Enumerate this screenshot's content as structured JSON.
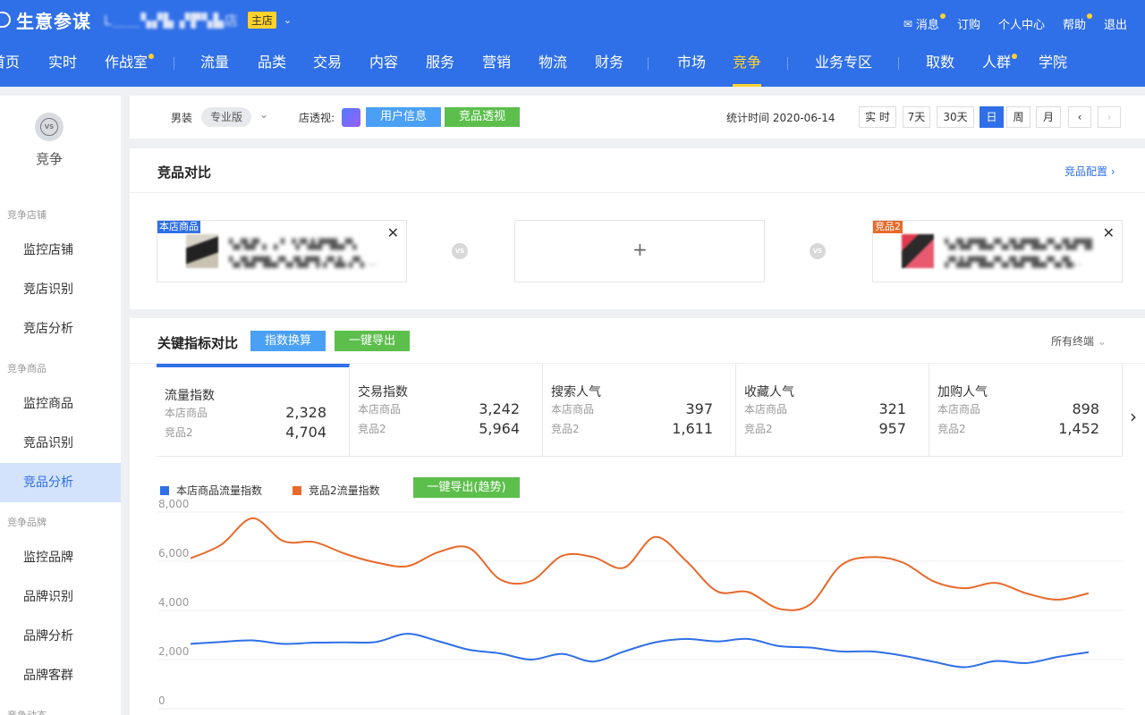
{
  "header": {
    "app_name": "生意参谋",
    "shop_name": "L＿＿▚▞▙ ▞▛▚▙店",
    "shop_badge": "主店",
    "links": [
      {
        "label": "消息",
        "dot": true
      },
      {
        "label": "订购",
        "dot": false
      },
      {
        "label": "个人中心",
        "dot": false
      },
      {
        "label": "帮助",
        "dot": true
      },
      {
        "label": "退出",
        "dot": false
      }
    ]
  },
  "nav": {
    "items": [
      {
        "label": "首页"
      },
      {
        "label": "实时"
      },
      {
        "label": "作战室",
        "dot": true
      },
      {
        "label": "流量"
      },
      {
        "label": "品类"
      },
      {
        "label": "交易"
      },
      {
        "label": "内容"
      },
      {
        "label": "服务"
      },
      {
        "label": "营销"
      },
      {
        "label": "物流"
      },
      {
        "label": "财务"
      },
      {
        "label": "市场"
      },
      {
        "label": "竞争",
        "active": true
      },
      {
        "label": "业务专区"
      },
      {
        "label": "取数"
      },
      {
        "label": "人群",
        "dot": true
      },
      {
        "label": "学院"
      }
    ]
  },
  "sidebar": {
    "title": "竞争",
    "icon_text": "VS",
    "groups": [
      "竞争店铺",
      "竞争商品",
      "竞争品牌",
      "竞争动态"
    ],
    "items": [
      "监控店铺",
      "竞店识别",
      "竞店分析",
      "监控商品",
      "竞品识别",
      "竞品分析",
      "监控品牌",
      "品牌识别",
      "品牌分析",
      "品牌客群"
    ],
    "active_item": "竞品分析"
  },
  "filter": {
    "category": "男装",
    "edition": "专业版",
    "insight_label": "店透视:",
    "user_info_button": "用户信息",
    "product_insight_button": "竞品透视",
    "stat_time": "统计时间 2020-06-14",
    "time_buttons": [
      "实 时",
      "7天",
      "30天",
      "日",
      "周",
      "月"
    ],
    "active_time": "日",
    "prev": "‹",
    "next": "›"
  },
  "compare": {
    "title": "竞品对比",
    "config_link": "竞品配置 ›",
    "slot1_tag": "本店商品",
    "slot1_text_line1": "▚▞▙▛ ▖▗ ▘▝▞▚▙▛▜▙▞▚",
    "slot1_text_line2": "▚▞▙▛▜▙▞▚▞▙▛▜ ▞▚▙ ▞▚ ...",
    "slot3_tag": "竞品2",
    "slot3_text_line1": "▚▞▙▛▜▙▞▚▞▙▛▜▙▞▚▞▙▛▜▙",
    "slot3_text_line2": "▞▚▙▛▜▙▞▚▞▙▛▜▙▞▚▞▙...",
    "add_symbol": "+",
    "vs": "VS",
    "close": "✕"
  },
  "metrics": {
    "title": "关键指标对比",
    "convert_button": "指数换算",
    "export_button": "一键导出",
    "terminal": "所有终端",
    "own_label": "本店商品",
    "rival_label": "竞品2",
    "cards": [
      {
        "name": "流量指数",
        "own": "2,328",
        "rival": "4,704"
      },
      {
        "name": "交易指数",
        "own": "3,242",
        "rival": "5,964"
      },
      {
        "name": "搜索人气",
        "own": "397",
        "rival": "1,611"
      },
      {
        "name": "收藏人气",
        "own": "321",
        "rival": "957"
      },
      {
        "name": "加购人气",
        "own": "898",
        "rival": "1,452"
      }
    ],
    "next_arrow": "›"
  },
  "trend": {
    "export_trend_button": "一键导出(趋势)"
  },
  "chart_data": {
    "type": "line",
    "ylim": [
      0,
      8000
    ],
    "y_ticks": [
      "8,000",
      "6,000",
      "4,000",
      "2,000",
      "0"
    ],
    "y_tick_values": [
      8000,
      6000,
      4000,
      2000,
      0
    ],
    "grid": true,
    "legend_position": "top-left",
    "series": [
      {
        "name": "本店商品流量指数",
        "color": "#2f6fe8",
        "values": [
          2640,
          2720,
          2780,
          2640,
          2690,
          2700,
          2720,
          3050,
          2750,
          2400,
          2250,
          2000,
          2230,
          1920,
          2330,
          2700,
          2840,
          2740,
          2840,
          2550,
          2490,
          2330,
          2330,
          2160,
          1910,
          1690,
          1940,
          1860,
          2110,
          2300
        ]
      },
      {
        "name": "竞品2流量指数",
        "color": "#e8692a",
        "values": [
          6120,
          6680,
          7750,
          6820,
          6780,
          6300,
          5950,
          5800,
          6370,
          6540,
          5260,
          5200,
          6220,
          6170,
          5740,
          6990,
          6020,
          4780,
          4750,
          4070,
          4240,
          5830,
          6170,
          5950,
          5180,
          4900,
          5120,
          4690,
          4440,
          4700
        ]
      }
    ]
  }
}
